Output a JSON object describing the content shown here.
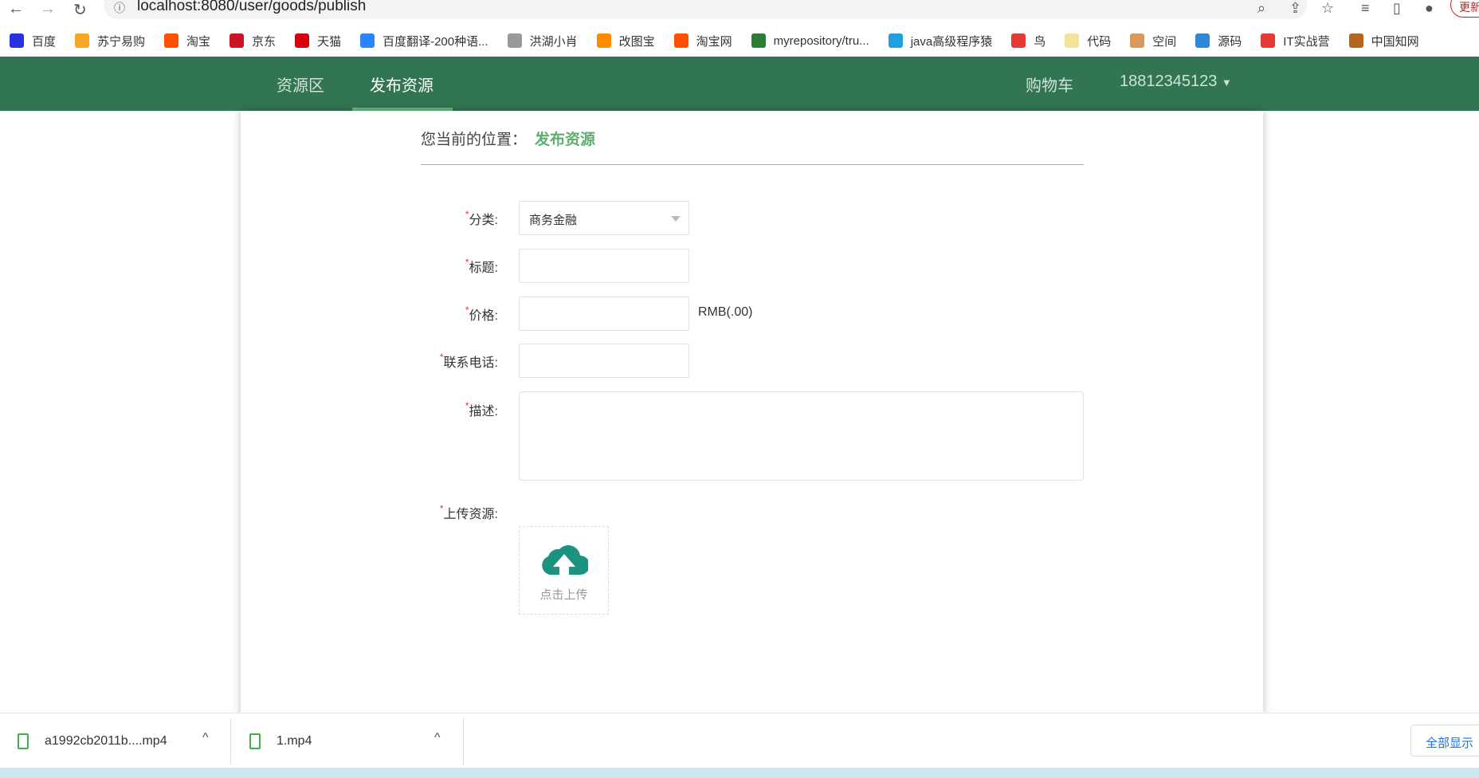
{
  "browser": {
    "url": "localhost:8080/user/goods/publish",
    "update_label": "更新",
    "bookmarks": [
      {
        "label": "百度",
        "color": "#2932e1"
      },
      {
        "label": "苏宁易购",
        "color": "#f5a623"
      },
      {
        "label": "淘宝",
        "color": "#ff5000"
      },
      {
        "label": "京东",
        "color": "#c91623"
      },
      {
        "label": "天猫",
        "color": "#d7000f"
      },
      {
        "label": "百度翻译-200种语...",
        "color": "#2a84ff"
      },
      {
        "label": "洪湖小肖",
        "color": "#999999"
      },
      {
        "label": "改图宝",
        "color": "#ff8a00"
      },
      {
        "label": "淘宝网",
        "color": "#ff5000"
      },
      {
        "label": "myrepository/tru...",
        "color": "#2f7d32"
      },
      {
        "label": "java高级程序猿",
        "color": "#20a0e0"
      },
      {
        "label": "鸟",
        "color": "#e53935"
      },
      {
        "label": "代码",
        "color": "#f3e29a"
      },
      {
        "label": "空间",
        "color": "#d79a5a"
      },
      {
        "label": "源码",
        "color": "#2e88d8"
      },
      {
        "label": "IT实战营",
        "color": "#e53935"
      },
      {
        "label": "中国知网",
        "color": "#b5651d"
      }
    ]
  },
  "nav": {
    "items": [
      "资源区",
      "发布资源"
    ],
    "active": 1,
    "cart": "购物车",
    "user": "18812345123",
    "bg": "#327552"
  },
  "breadcrumb": {
    "prefix": "您当前的位置：",
    "current": "发布资源"
  },
  "form": {
    "category": {
      "label": "分类:",
      "value": "商务金融"
    },
    "title": {
      "label": "标题:",
      "value": ""
    },
    "price": {
      "label": "价格:",
      "value": "",
      "unit": "RMB(.00)"
    },
    "phone": {
      "label": "联系电话:",
      "value": ""
    },
    "desc": {
      "label": "描述:",
      "value": ""
    },
    "upload": {
      "label": "上传资源:",
      "button": "点击上传"
    },
    "required_mark": "*"
  },
  "downloads": {
    "items": [
      "a1992cb2011b....mp4",
      "1.mp4"
    ],
    "show_all": "全部显示"
  }
}
